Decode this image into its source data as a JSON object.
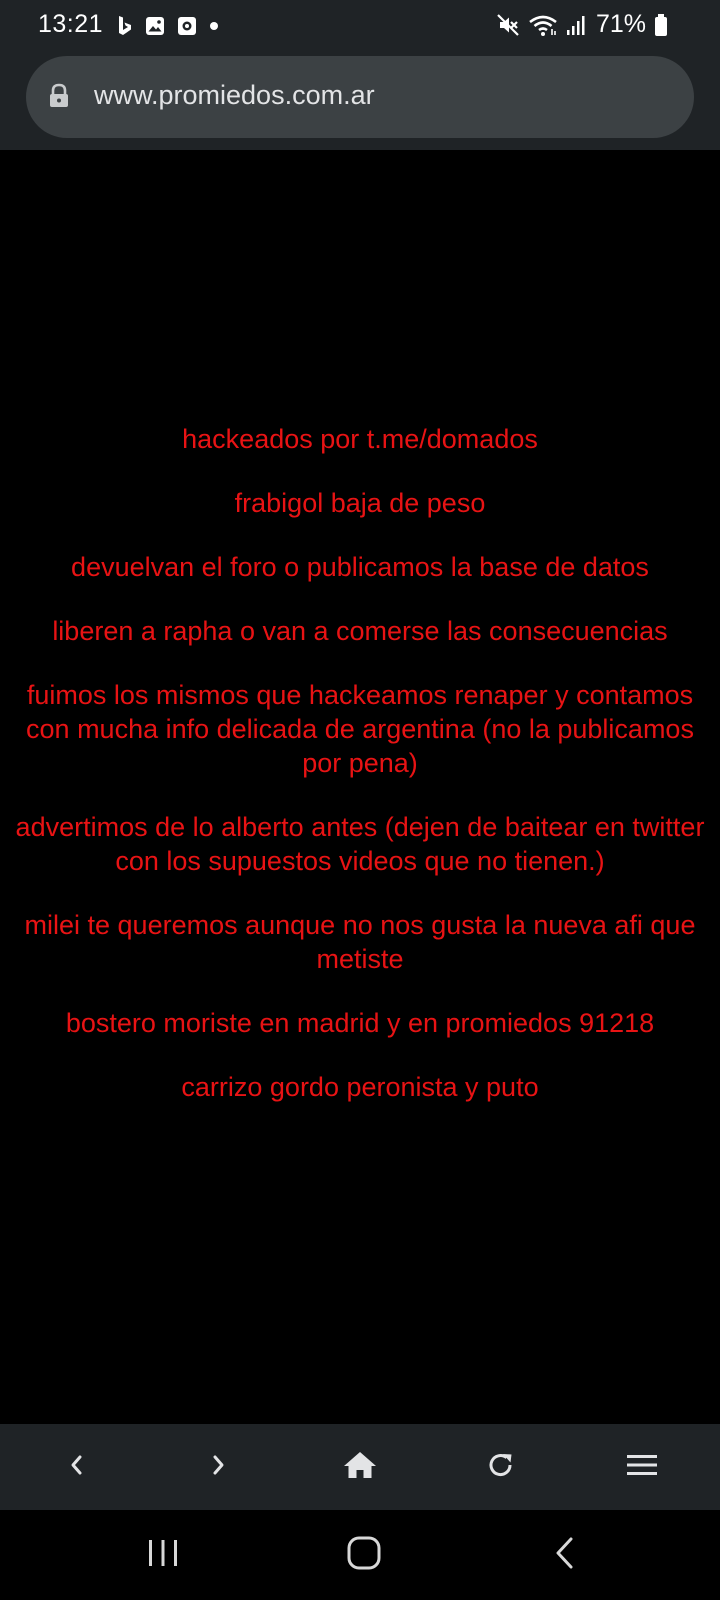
{
  "status_bar": {
    "time": "13:21",
    "notification_icons": [
      "bing-icon",
      "gallery-icon",
      "screen-recorder-icon",
      "dot-icon"
    ],
    "system_icons": [
      "mute-icon",
      "wifi-icon",
      "signal-icon"
    ],
    "battery_percent": "71%"
  },
  "browser": {
    "url": "www.promiedos.com.ar",
    "lock_icon": "lock-icon"
  },
  "page": {
    "text_color": "#e81314",
    "background": "#000000",
    "messages": [
      "hackeados por t.me/domados",
      "frabigol baja de peso",
      "devuelvan el foro o publicamos la base de datos",
      "liberen a rapha o van a comerse las consecuencias",
      "fuimos los mismos que hackeamos renaper y contamos con mucha info delicada de argentina (no la publicamos por pena)",
      "advertimos de lo alberto antes (dejen de baitear en twitter con los supuestos videos que no tienen.)",
      "milei te queremos aunque no nos gusta la nueva afi que metiste",
      "bostero moriste en madrid y en promiedos 91218",
      "carrizo gordo peronista y puto"
    ]
  },
  "toolbar": {
    "buttons": [
      "back-icon",
      "forward-icon",
      "home-icon",
      "reload-icon",
      "menu-icon"
    ]
  },
  "nav_bar": {
    "buttons": [
      "recent-apps-icon",
      "home-button-icon",
      "back-nav-icon"
    ]
  }
}
